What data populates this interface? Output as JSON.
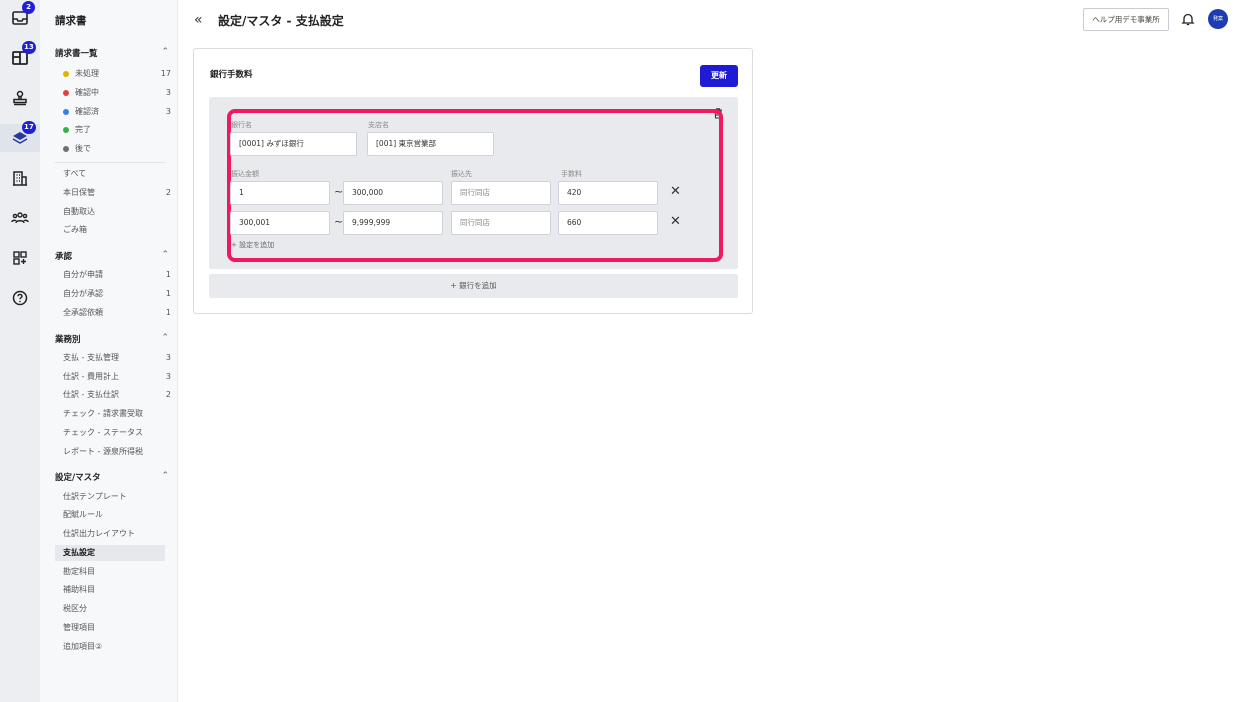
{
  "rail": {
    "items": [
      {
        "icon": "inbox-icon",
        "badge": "2"
      },
      {
        "icon": "layout-icon",
        "badge": "13"
      },
      {
        "icon": "stamp-icon",
        "badge": ""
      },
      {
        "icon": "layers-icon",
        "badge": "17"
      },
      {
        "icon": "building-icon",
        "badge": ""
      },
      {
        "icon": "users-icon",
        "badge": ""
      },
      {
        "icon": "apps-add-icon",
        "badge": ""
      },
      {
        "icon": "help-icon",
        "badge": ""
      }
    ]
  },
  "sidebar": {
    "title": "請求書",
    "invoice_list": {
      "label": "請求書一覧",
      "statuses": [
        {
          "label": "未処理",
          "count": "17",
          "color": "#e0b400"
        },
        {
          "label": "確認中",
          "count": "3",
          "color": "#e04040"
        },
        {
          "label": "確認済",
          "count": "3",
          "color": "#3d7be6"
        },
        {
          "label": "完了",
          "count": "",
          "color": "#36b24a"
        },
        {
          "label": "後で",
          "count": "",
          "color": "#6b6f78"
        }
      ],
      "others": [
        {
          "label": "すべて",
          "count": ""
        },
        {
          "label": "本日保管",
          "count": "2"
        },
        {
          "label": "自動取込",
          "count": ""
        },
        {
          "label": "ごみ箱",
          "count": ""
        }
      ]
    },
    "approval": {
      "label": "承認",
      "items": [
        {
          "label": "自分が申請",
          "count": "1"
        },
        {
          "label": "自分が承認",
          "count": "1"
        },
        {
          "label": "全承認依頼",
          "count": "1"
        }
      ]
    },
    "business": {
      "label": "業務別",
      "items": [
        {
          "label": "支払 - 支払管理",
          "count": "3"
        },
        {
          "label": "仕訳 - 費用計上",
          "count": "3"
        },
        {
          "label": "仕訳 - 支払仕訳",
          "count": "2"
        },
        {
          "label": "チェック - 請求書受取",
          "count": ""
        },
        {
          "label": "チェック - ステータス",
          "count": ""
        },
        {
          "label": "レポート - 源泉所得税",
          "count": ""
        }
      ]
    },
    "settings": {
      "label": "設定/マスタ",
      "items": [
        {
          "label": "仕訳テンプレート"
        },
        {
          "label": "配賦ルール"
        },
        {
          "label": "仕訳出力レイアウト"
        },
        {
          "label": "支払設定"
        },
        {
          "label": "勘定科目"
        },
        {
          "label": "補助科目"
        },
        {
          "label": "税区分"
        },
        {
          "label": "管理項目"
        },
        {
          "label": "追加項目②"
        }
      ]
    }
  },
  "header": {
    "back": "«",
    "title": "設定/マスタ - 支払設定",
    "help_button": "ヘルプ用デモ事業所",
    "avatar": "発案"
  },
  "card": {
    "title": "銀行手数料",
    "update_button": "更新",
    "bank_name_label": "銀行名",
    "bank_name_value": "[0001] みずほ銀行",
    "branch_label": "支店名",
    "branch_value": "[001] 東京営業部",
    "amount_label": "振込金額",
    "dest_label": "振込先",
    "fee_label": "手数料",
    "tilde": "~",
    "close_glyph": "✕",
    "rows": [
      {
        "from": "1",
        "to": "300,000",
        "dest": "同行同店",
        "fee": "420"
      },
      {
        "from": "300,001",
        "to": "9,999,999",
        "dest": "同行同店",
        "fee": "660"
      }
    ],
    "add_setting": "+ 設定を追加",
    "add_bank": "+ 銀行を追加"
  }
}
